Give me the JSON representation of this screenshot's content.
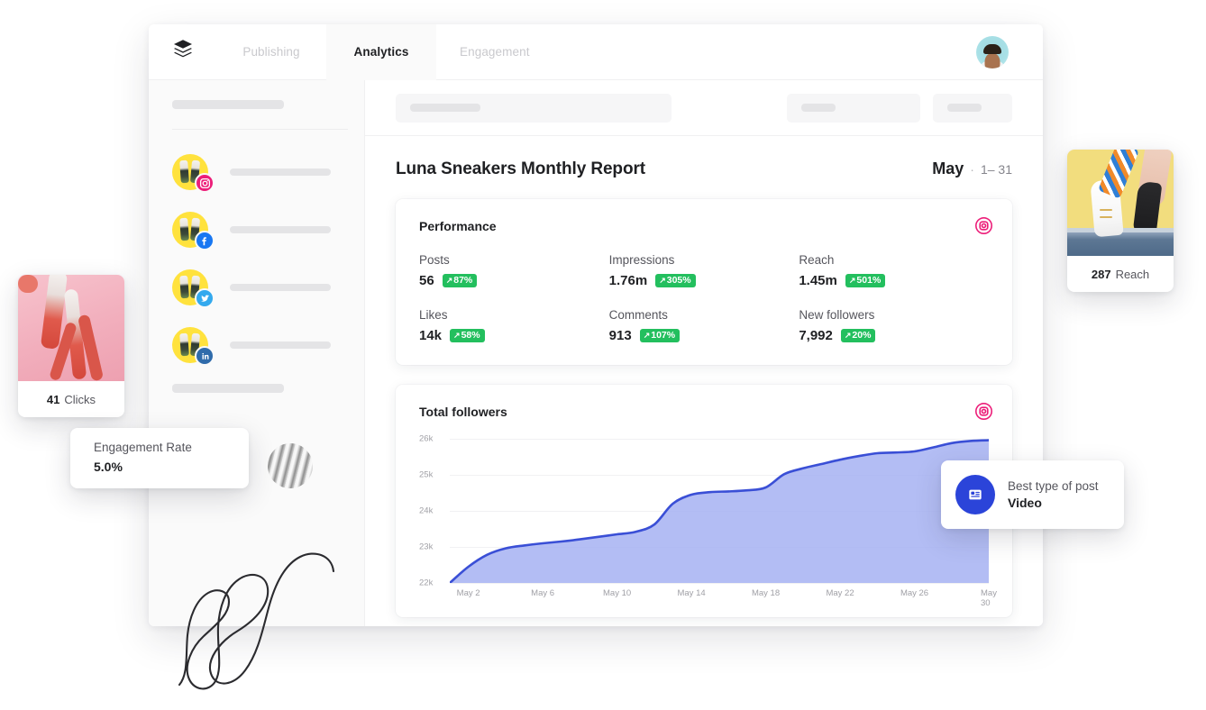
{
  "app": {
    "logo_icon": "buffer-stacked-layers-logo",
    "tabs": [
      {
        "label": "Publishing",
        "active": false
      },
      {
        "label": "Analytics",
        "active": true
      },
      {
        "label": "Engagement",
        "active": false
      }
    ],
    "avatar_icon": "user-avatar"
  },
  "sidebar": {
    "accounts": [
      {
        "network": "instagram",
        "icon": "instagram-icon"
      },
      {
        "network": "facebook",
        "icon": "facebook-icon"
      },
      {
        "network": "twitter",
        "icon": "twitter-icon"
      },
      {
        "network": "linkedin",
        "icon": "linkedin-icon"
      }
    ]
  },
  "toolbar": {
    "search_icon": "search-field-placeholder",
    "filter_icon": "filter-pill-placeholder",
    "export_icon": "export-pill-placeholder"
  },
  "report": {
    "title": "Luna Sneakers Monthly Report",
    "month": "May",
    "separator": "·",
    "range": "1– 31"
  },
  "performance": {
    "title": "Performance",
    "network_icon": "instagram-icon",
    "metrics": [
      {
        "label": "Posts",
        "value": "56",
        "delta": "87%",
        "trend": "up"
      },
      {
        "label": "Impressions",
        "value": "1.76m",
        "delta": "305%",
        "trend": "up"
      },
      {
        "label": "Reach",
        "value": "1.45m",
        "delta": "501%",
        "trend": "up"
      },
      {
        "label": "Likes",
        "value": "14k",
        "delta": "58%",
        "trend": "up"
      },
      {
        "label": "Comments",
        "value": "913",
        "delta": "107%",
        "trend": "up"
      },
      {
        "label": "New followers",
        "value": "7,992",
        "delta": "20%",
        "trend": "up"
      }
    ],
    "trend_arrow": "↗"
  },
  "followers_chart": {
    "title": "Total followers",
    "network_icon": "instagram-icon"
  },
  "chart_data": {
    "type": "area",
    "title": "Total followers",
    "xlabel": "",
    "ylabel": "",
    "ylim": [
      22000,
      26000
    ],
    "grid": true,
    "legend": "none",
    "line_color": "#3a4fd6",
    "fill_color": "#a6b1f2",
    "ytick_labels": [
      "22k",
      "23k",
      "24k",
      "25k",
      "26k"
    ],
    "ytick_values": [
      22000,
      23000,
      24000,
      25000,
      26000
    ],
    "xtick_labels": [
      "May 2",
      "May 6",
      "May 10",
      "May 14",
      "May 18",
      "May 22",
      "May 26",
      "May 30"
    ],
    "xtick_values": [
      2,
      6,
      10,
      14,
      18,
      22,
      26,
      30
    ],
    "x": [
      1,
      2,
      3,
      4,
      5,
      6,
      7,
      8,
      9,
      10,
      11,
      12,
      13,
      14,
      15,
      16,
      17,
      18,
      19,
      20,
      21,
      22,
      23,
      24,
      25,
      26,
      27,
      28,
      29,
      30
    ],
    "values": [
      22000,
      22450,
      22780,
      22960,
      23040,
      23100,
      23150,
      23210,
      23280,
      23350,
      23420,
      23620,
      24200,
      24450,
      24520,
      24540,
      24570,
      24650,
      25020,
      25180,
      25300,
      25420,
      25520,
      25600,
      25620,
      25650,
      25760,
      25880,
      25940,
      25960
    ]
  },
  "callouts": {
    "clicks": {
      "value": "41",
      "label": "Clicks",
      "image": "sneaker-legs-pink-photo"
    },
    "reach": {
      "value": "287",
      "label": "Reach",
      "image": "sneaker-heel-yellow-photo"
    },
    "engagement": {
      "label": "Engagement Rate",
      "value": "5.0%"
    },
    "best_post": {
      "label": "Best type of post",
      "value": "Video",
      "icon": "video-post-icon"
    }
  },
  "colors": {
    "accent_blue": "#2b44d9",
    "chart_line": "#3a4fd6",
    "chart_fill": "#a6b1f2",
    "positive_green": "#23bf5e",
    "instagram_pink": "#ec1e79",
    "facebook_blue": "#1877f2",
    "twitter_blue": "#33a9ee",
    "linkedin_blue": "#2f6bab"
  }
}
